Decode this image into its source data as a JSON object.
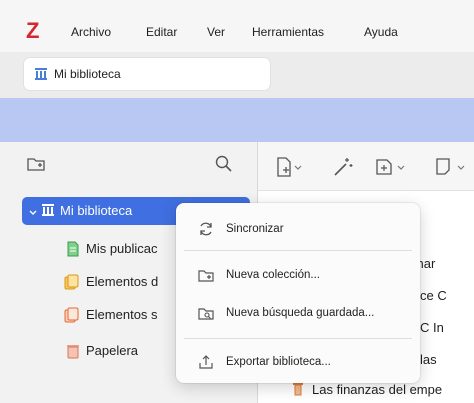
{
  "app": {
    "logo_letter": "Z",
    "brand_color": "#d6272e"
  },
  "menubar": {
    "items": [
      "Archivo",
      "Editar",
      "Ver",
      "Herramientas",
      "Ayuda"
    ]
  },
  "tab": {
    "label": "Mi biblioteca",
    "icon": "library-icon"
  },
  "colors": {
    "accent": "#3f6fe0",
    "band": "#b9c7f3"
  },
  "collections_pane": {
    "new_collection_icon": "new-collection-icon",
    "search_icon": "search-icon",
    "items": [
      {
        "label": "Mi biblioteca",
        "icon": "library-icon",
        "selected": true,
        "expanded": true
      },
      {
        "label": "Mis publicac",
        "icon": "my-publications-icon"
      },
      {
        "label": "Elementos d",
        "icon": "duplicate-items-icon"
      },
      {
        "label": "Elementos s",
        "icon": "unfiled-items-icon"
      },
      {
        "label": "Papelera",
        "icon": "trash-icon"
      }
    ]
  },
  "items_pane": {
    "toolbar": [
      "new-item-icon",
      "magic-wand-icon",
      "new-note-icon",
      "attachment-icon"
    ],
    "visible_fragments": [
      "finar",
      "ce C",
      "C In",
      "las",
      "Las finanzas del empe"
    ]
  },
  "context_menu": {
    "items": [
      {
        "label": "Sincronizar",
        "icon": "sync-icon"
      },
      {
        "label": "Nueva colección...",
        "icon": "new-collection-icon"
      },
      {
        "label": "Nueva búsqueda guardada...",
        "icon": "saved-search-icon"
      },
      {
        "label": "Exportar biblioteca...",
        "icon": "export-icon"
      }
    ]
  }
}
